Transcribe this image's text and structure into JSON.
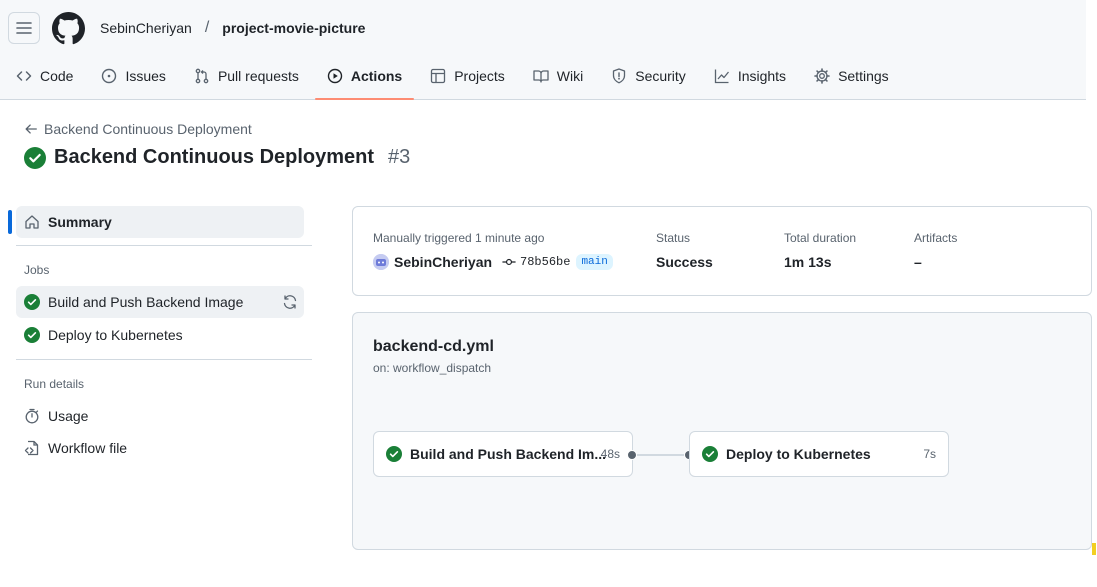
{
  "header": {
    "owner": "SebinCheriyan",
    "separator": "/",
    "repo": "project-movie-picture"
  },
  "tabs": [
    {
      "label": "Code",
      "icon": "code-icon"
    },
    {
      "label": "Issues",
      "icon": "issue-icon"
    },
    {
      "label": "Pull requests",
      "icon": "pull-request-icon"
    },
    {
      "label": "Actions",
      "icon": "play-icon",
      "active": true
    },
    {
      "label": "Projects",
      "icon": "table-icon"
    },
    {
      "label": "Wiki",
      "icon": "book-icon"
    },
    {
      "label": "Security",
      "icon": "shield-icon"
    },
    {
      "label": "Insights",
      "icon": "graph-icon"
    },
    {
      "label": "Settings",
      "icon": "gear-icon"
    }
  ],
  "run": {
    "back_label": "Backend Continuous Deployment",
    "title": "Backend Continuous Deployment",
    "number": "#3",
    "status_icon": "check-circle-icon"
  },
  "sidebar": {
    "summary": "Summary",
    "jobs_heading": "Jobs",
    "jobs": [
      {
        "label": "Build and Push Backend Image"
      },
      {
        "label": "Deploy to Kubernetes"
      }
    ],
    "run_details_heading": "Run details",
    "details": [
      {
        "label": "Usage",
        "icon": "stopwatch-icon"
      },
      {
        "label": "Workflow file",
        "icon": "file-code-icon"
      }
    ]
  },
  "summary": {
    "trigger_label": "Manually triggered 1 minute ago",
    "actor": "SebinCheriyan",
    "commit": "78b56be",
    "branch": "main",
    "status_label": "Status",
    "status_value": "Success",
    "duration_label": "Total duration",
    "duration_value": "1m 13s",
    "artifacts_label": "Artifacts",
    "artifacts_value": "–"
  },
  "graph": {
    "workflow_file": "backend-cd.yml",
    "trigger": "on: workflow_dispatch",
    "jobs": [
      {
        "label": "Build and Push Backend Im...",
        "duration": "48s"
      },
      {
        "label": "Deploy to Kubernetes",
        "duration": "7s"
      }
    ]
  },
  "colors": {
    "success": "#1a7f37",
    "accent": "#0969da",
    "active_tab_underline": "#fd8c73"
  }
}
